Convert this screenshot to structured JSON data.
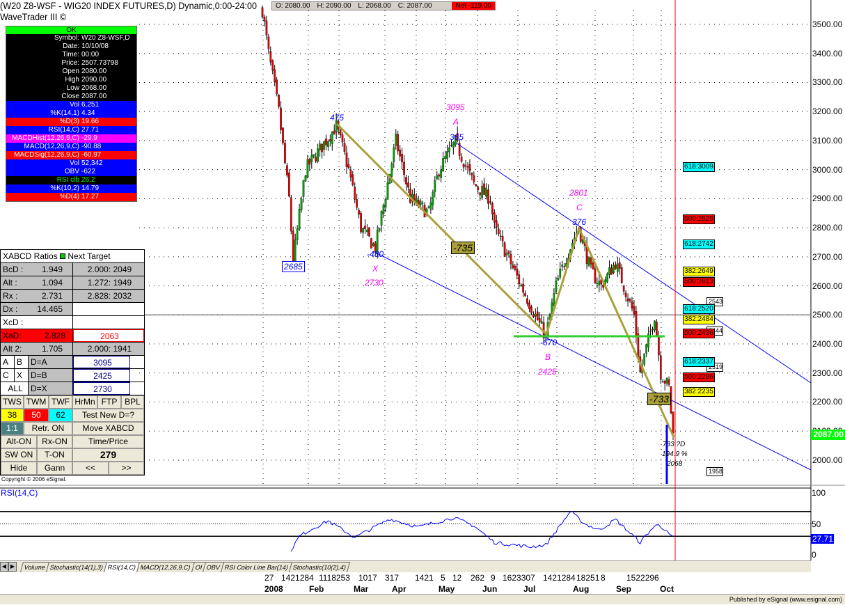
{
  "header": {
    "title": "(W20 Z8-WSF - WIG20 INDEX FUTURES,D) Dynamic,0:00-24:00",
    "subtitle": "WaveTrader III ©"
  },
  "ohlc": {
    "open": "O: 2080.00",
    "high": "H: 2090.00",
    "low": "L: 2068.00",
    "close": "C: 2087.00",
    "net": "Net -119.00"
  },
  "info_panel": {
    "status": "OK",
    "rows": [
      {
        "label": "Symbol:",
        "value": "W20 Z8-WSF,D",
        "bg": "#000000",
        "color": "#ffffff"
      },
      {
        "label": "Date:",
        "value": "10/10/08",
        "bg": "#000000",
        "color": "#ffffff"
      },
      {
        "label": "Time:",
        "value": "00:00",
        "bg": "#000000",
        "color": "#ffffff"
      },
      {
        "label": "Price:",
        "value": "2507.73798",
        "bg": "#000000",
        "color": "#ffffff"
      },
      {
        "label": "Open",
        "value": "2080.00",
        "bg": "#000000",
        "color": "#ffffff"
      },
      {
        "label": "High",
        "value": "2090.00",
        "bg": "#000000",
        "color": "#ffffff"
      },
      {
        "label": "Low",
        "value": "2068.00",
        "bg": "#000000",
        "color": "#ffffff"
      },
      {
        "label": "Close",
        "value": "2087.00",
        "bg": "#000000",
        "color": "#ffffff"
      },
      {
        "label": "Vol",
        "value": "6,251",
        "bg": "#0000ff",
        "color": "#ffffff"
      },
      {
        "label": "%K(14,1)",
        "value": "4.34",
        "bg": "#0000ff",
        "color": "#ffffff"
      },
      {
        "label": "%D(3)",
        "value": "19.66",
        "bg": "#ff0000",
        "color": "#ffffff"
      },
      {
        "label": "RSI(14,C)",
        "value": "27.71",
        "bg": "#0000ff",
        "color": "#ffffff"
      },
      {
        "label": "MACDHist(12,26,9,C)",
        "value": "-29.9",
        "bg": "#ff00ff",
        "color": "#ffffff"
      },
      {
        "label": "MACD(12,26,9,C)",
        "value": "-90.88",
        "bg": "#0000ff",
        "color": "#ffffff"
      },
      {
        "label": "MACDSig(12,26,9,C)",
        "value": "-60.97",
        "bg": "#ff0000",
        "color": "#ffffff"
      },
      {
        "label": "Vol",
        "value": "52,342",
        "bg": "#0000ff",
        "color": "#ffffff"
      },
      {
        "label": "OBV",
        "value": "-622",
        "bg": "#0000ff",
        "color": "#ffffff"
      },
      {
        "label": "RSI clb",
        "value": "26.2",
        "bg": "#000000",
        "color": "#00ff00"
      },
      {
        "label": "%K(10,2)",
        "value": "14.79",
        "bg": "#0000ff",
        "color": "#ffffff"
      },
      {
        "label": "%D(4)",
        "value": "17.27",
        "bg": "#ff0000",
        "color": "#ffffff"
      }
    ]
  },
  "xabcd": {
    "header": "XABCD Ratios",
    "header2": "Next Target",
    "ratios": [
      {
        "label": "BcD :",
        "value": "1.949",
        "target": "2.000: 2049"
      },
      {
        "label": "Alt  :",
        "value": "1.094",
        "target": "1.272: 1949"
      },
      {
        "label": "Rx   :",
        "value": "2.731",
        "target": "2.828: 2032"
      },
      {
        "label": "Dx   :",
        "value": "14.465",
        "target": ""
      }
    ],
    "xcd": "XcD :",
    "xad_label": "XaD:",
    "xad_value": "2.828",
    "xad_target": "2063",
    "alt2_label": "Alt 2:",
    "alt2_value": "1.705",
    "alt2_target": "2.000: 1941",
    "d_rows": [
      {
        "a": "A",
        "b": "B",
        "label": "D=A",
        "value": "3095"
      },
      {
        "a": "C",
        "b": "X",
        "label": "D=B",
        "value": "2425"
      },
      {
        "a": "ALL",
        "b": "",
        "label": "D=X",
        "value": "2730"
      }
    ],
    "buttons": {
      "tws": "TWS",
      "twm": "TWM",
      "twf": "TWF",
      "hrmn": "HrMn",
      "ftp": "FTP",
      "bpl": "BPL",
      "v38": "38",
      "v50": "50",
      "v62": "62",
      "test": "Test New D=?",
      "ratio": "1:1",
      "retr": "Retr. ON",
      "move": "Move XABCD",
      "alt": "Alt-ON",
      "rx": "Rx-ON",
      "timeprice": "Time/Price",
      "sw": "SW ON",
      "t": "T-ON",
      "count": "279",
      "hide": "Hide",
      "gann": "Gann",
      "prev": "<<",
      "next": ">>"
    },
    "copyright": "Copyright © 2006 eSignal."
  },
  "annotations": {
    "p475": "475",
    "p2685": "2685",
    "m430": "-430",
    "X": "X",
    "p2730": "2730",
    "p3095": "3095",
    "A": "A",
    "p365": "365",
    "m735": "-735",
    "m670": "-670",
    "B": "B",
    "p2425": "2425",
    "p2801": "2801",
    "C": "C",
    "p376": "376",
    "m733": "-733",
    "d733": "733 ?D",
    "pct": "194.9 %",
    "p2068": "2068"
  },
  "fib_levels": [
    {
      "text": "618:3009",
      "price": 3009,
      "color": "#00ffff"
    },
    {
      "text": "500:2829",
      "price": 2829,
      "color": "#ff0000"
    },
    {
      "text": "618:2742",
      "price": 2742,
      "color": "#00ffff"
    },
    {
      "text": "382:2649",
      "price": 2649,
      "color": "#ffff00"
    },
    {
      "text": "500:2613",
      "price": 2613,
      "color": "#ff0000"
    },
    {
      "text": "618:2520",
      "price": 2520,
      "color": "#00ffff"
    },
    {
      "text": "382:2484",
      "price": 2484,
      "color": "#ffff00"
    },
    {
      "text": "500:2436",
      "price": 2436,
      "color": "#ff0000"
    },
    {
      "text": "618:2337",
      "price": 2337,
      "color": "#00ffff"
    },
    {
      "text": "500:2286",
      "price": 2286,
      "color": "#ff0000"
    },
    {
      "text": "382:2235",
      "price": 2235,
      "color": "#ffff00"
    }
  ],
  "white_boxes": [
    {
      "text": "2543",
      "price": 2543
    },
    {
      "text": "2444",
      "price": 2444
    },
    {
      "text": "2319",
      "price": 2319
    },
    {
      "text": "1958",
      "price": 1958
    }
  ],
  "last_price": "2087.00",
  "rsi_last": "27.71",
  "rsi_label": "RSI(14,C)",
  "tabs": [
    "Volume",
    "Stochastic(14(1),3)",
    "RSI(14,C)",
    "MACD(12,26,9,C)",
    "OI",
    "OBV",
    "RSI Color Line Bar(14)",
    "Stochastic(10(2),4)"
  ],
  "active_tab": 2,
  "x_days": [
    "27",
    "1421284",
    "1118253",
    "1017",
    "317",
    "1421",
    "5",
    "12",
    "262",
    "9",
    "1623307",
    "1421284",
    "18251",
    "8",
    "1522296"
  ],
  "x_months": [
    "2008",
    "Feb",
    "Mar",
    "Apr",
    "May",
    "Jun",
    "Jul",
    "Aug",
    "Sep",
    "Oct"
  ],
  "status": "Published by eSignal (www.esignal.com)",
  "chart_data": {
    "type": "candlestick",
    "title": "W20 Z8-WSF - WIG20 INDEX FUTURES, Daily",
    "ylim": [
      1920,
      3560
    ],
    "y_ticks": [
      "3500.00",
      "3400.00",
      "3300.00",
      "3200.00",
      "3100.00",
      "3000.00",
      "2900.00",
      "2800.00",
      "2700.00",
      "2600.00",
      "2500.00",
      "2400.00",
      "2300.00",
      "2200.00",
      "2100.00",
      "2000.00"
    ],
    "price_path": [
      [
        0,
        3550
      ],
      [
        3,
        3400
      ],
      [
        8,
        3200
      ],
      [
        13,
        2900
      ],
      [
        15,
        2685
      ],
      [
        21,
        3000
      ],
      [
        36,
        3150
      ],
      [
        42,
        3000
      ],
      [
        48,
        2800
      ],
      [
        55,
        2730
      ],
      [
        65,
        3100
      ],
      [
        72,
        2900
      ],
      [
        81,
        2850
      ],
      [
        86,
        3000
      ],
      [
        94,
        3095
      ],
      [
        103,
        2950
      ],
      [
        111,
        2900
      ],
      [
        113,
        2800
      ],
      [
        126,
        2600
      ],
      [
        138,
        2425
      ],
      [
        143,
        2600
      ],
      [
        148,
        2700
      ],
      [
        154,
        2801
      ],
      [
        160,
        2650
      ],
      [
        165,
        2600
      ],
      [
        172,
        2680
      ],
      [
        181,
        2500
      ],
      [
        184,
        2300
      ],
      [
        191,
        2500
      ],
      [
        194,
        2300
      ],
      [
        198,
        2250
      ],
      [
        200,
        2087
      ]
    ],
    "rsi": {
      "ylim": [
        0,
        100
      ],
      "ticks": [
        "100",
        "50",
        "0"
      ],
      "levels": [
        30,
        70
      ],
      "values": [
        [
          14,
          8
        ],
        [
          18,
          30
        ],
        [
          23,
          40
        ],
        [
          32,
          55
        ],
        [
          45,
          28
        ],
        [
          62,
          58
        ],
        [
          76,
          45
        ],
        [
          93,
          60
        ],
        [
          103,
          47
        ],
        [
          113,
          20
        ],
        [
          130,
          13
        ],
        [
          138,
          16
        ],
        [
          150,
          70
        ],
        [
          157,
          50
        ],
        [
          164,
          40
        ],
        [
          172,
          57
        ],
        [
          184,
          20
        ],
        [
          189,
          40
        ],
        [
          193,
          50
        ],
        [
          199,
          30
        ],
        [
          200,
          27.71
        ]
      ]
    }
  }
}
